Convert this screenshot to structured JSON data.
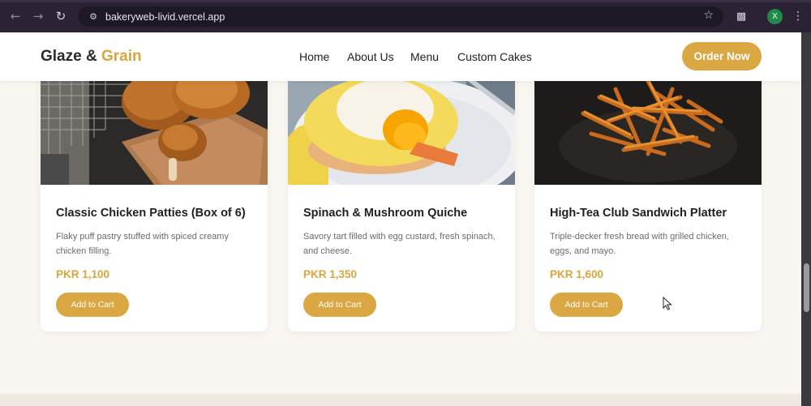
{
  "browser": {
    "url": "bakeryweb-livid.vercel.app",
    "profile_initial": "X",
    "icons": [
      "back-arrow-icon",
      "forward-arrow-icon",
      "reload-icon",
      "site-info-icon",
      "star-icon",
      "extensions-icon",
      "kebab-menu-icon"
    ]
  },
  "header": {
    "logo_part1": "Glaze &",
    "logo_part2": "Grain",
    "nav": [
      "Home",
      "About Us",
      "Menu",
      "Custom Cakes"
    ],
    "cta": "Order Now"
  },
  "products": [
    {
      "title": "Classic Chicken Patties (Box of 6)",
      "description": "Flaky puff pastry stuffed with spiced creamy chicken filling.",
      "price": "PKR 1,100",
      "button": "Add to Cart"
    },
    {
      "title": "Spinach & Mushroom Quiche",
      "description": "Savory tart filled with egg custard, fresh spinach, and cheese.",
      "price": "PKR 1,350",
      "button": "Add to Cart"
    },
    {
      "title": "High-Tea Club Sandwich Platter",
      "description": "Triple-decker fresh bread with grilled chicken, eggs, and mayo.",
      "price": "PKR 1,600",
      "button": "Add to Cart"
    }
  ],
  "colors": {
    "accent": "#dba743",
    "chrome": "#2b2335",
    "page_bg": "#faf7f2"
  }
}
